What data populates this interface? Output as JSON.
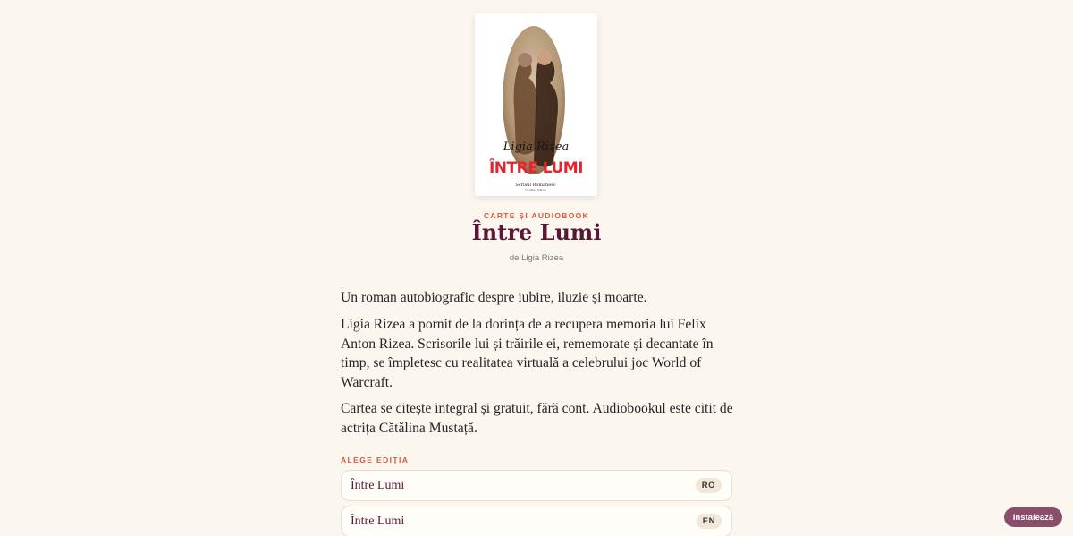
{
  "book": {
    "cover": {
      "author_script": "Ligia Rizea",
      "title": "ÎNTRE LUMI",
      "title_color": "#e8232c",
      "publisher_logo": "Scrisul Românesc",
      "publisher_sub": "Fundația · Editura"
    },
    "eyebrow": "CARTE ȘI AUDIOBOOK",
    "title": "Între Lumi",
    "byline": "de Ligia Rizea"
  },
  "description": {
    "p1": "Un roman autobiografic despre iubire, iluzie și moarte.",
    "p2": "Ligia Rizea a pornit de la dorința de a recupera memoria lui Felix Anton Rizea. Scrisorile lui și trăirile ei, rememorate și decantate în timp, se împletesc cu realitatea virtuală a celebrului joc World of Warcraft.",
    "p3": "Cartea se citește integral și gratuit, fără cont. Audiobookul este citit de actrița Cătălina Mustață."
  },
  "editions": {
    "label": "ALEGE EDIȚIA",
    "items": [
      {
        "name": "Între Lumi",
        "lang": "RO"
      },
      {
        "name": "Între Lumi",
        "lang": "EN"
      }
    ]
  },
  "install": {
    "label": "Instalează"
  },
  "colors": {
    "background": "#fbf7ef",
    "accent": "#d9573d",
    "title": "#5b1736",
    "button": "#8a4e6b"
  }
}
